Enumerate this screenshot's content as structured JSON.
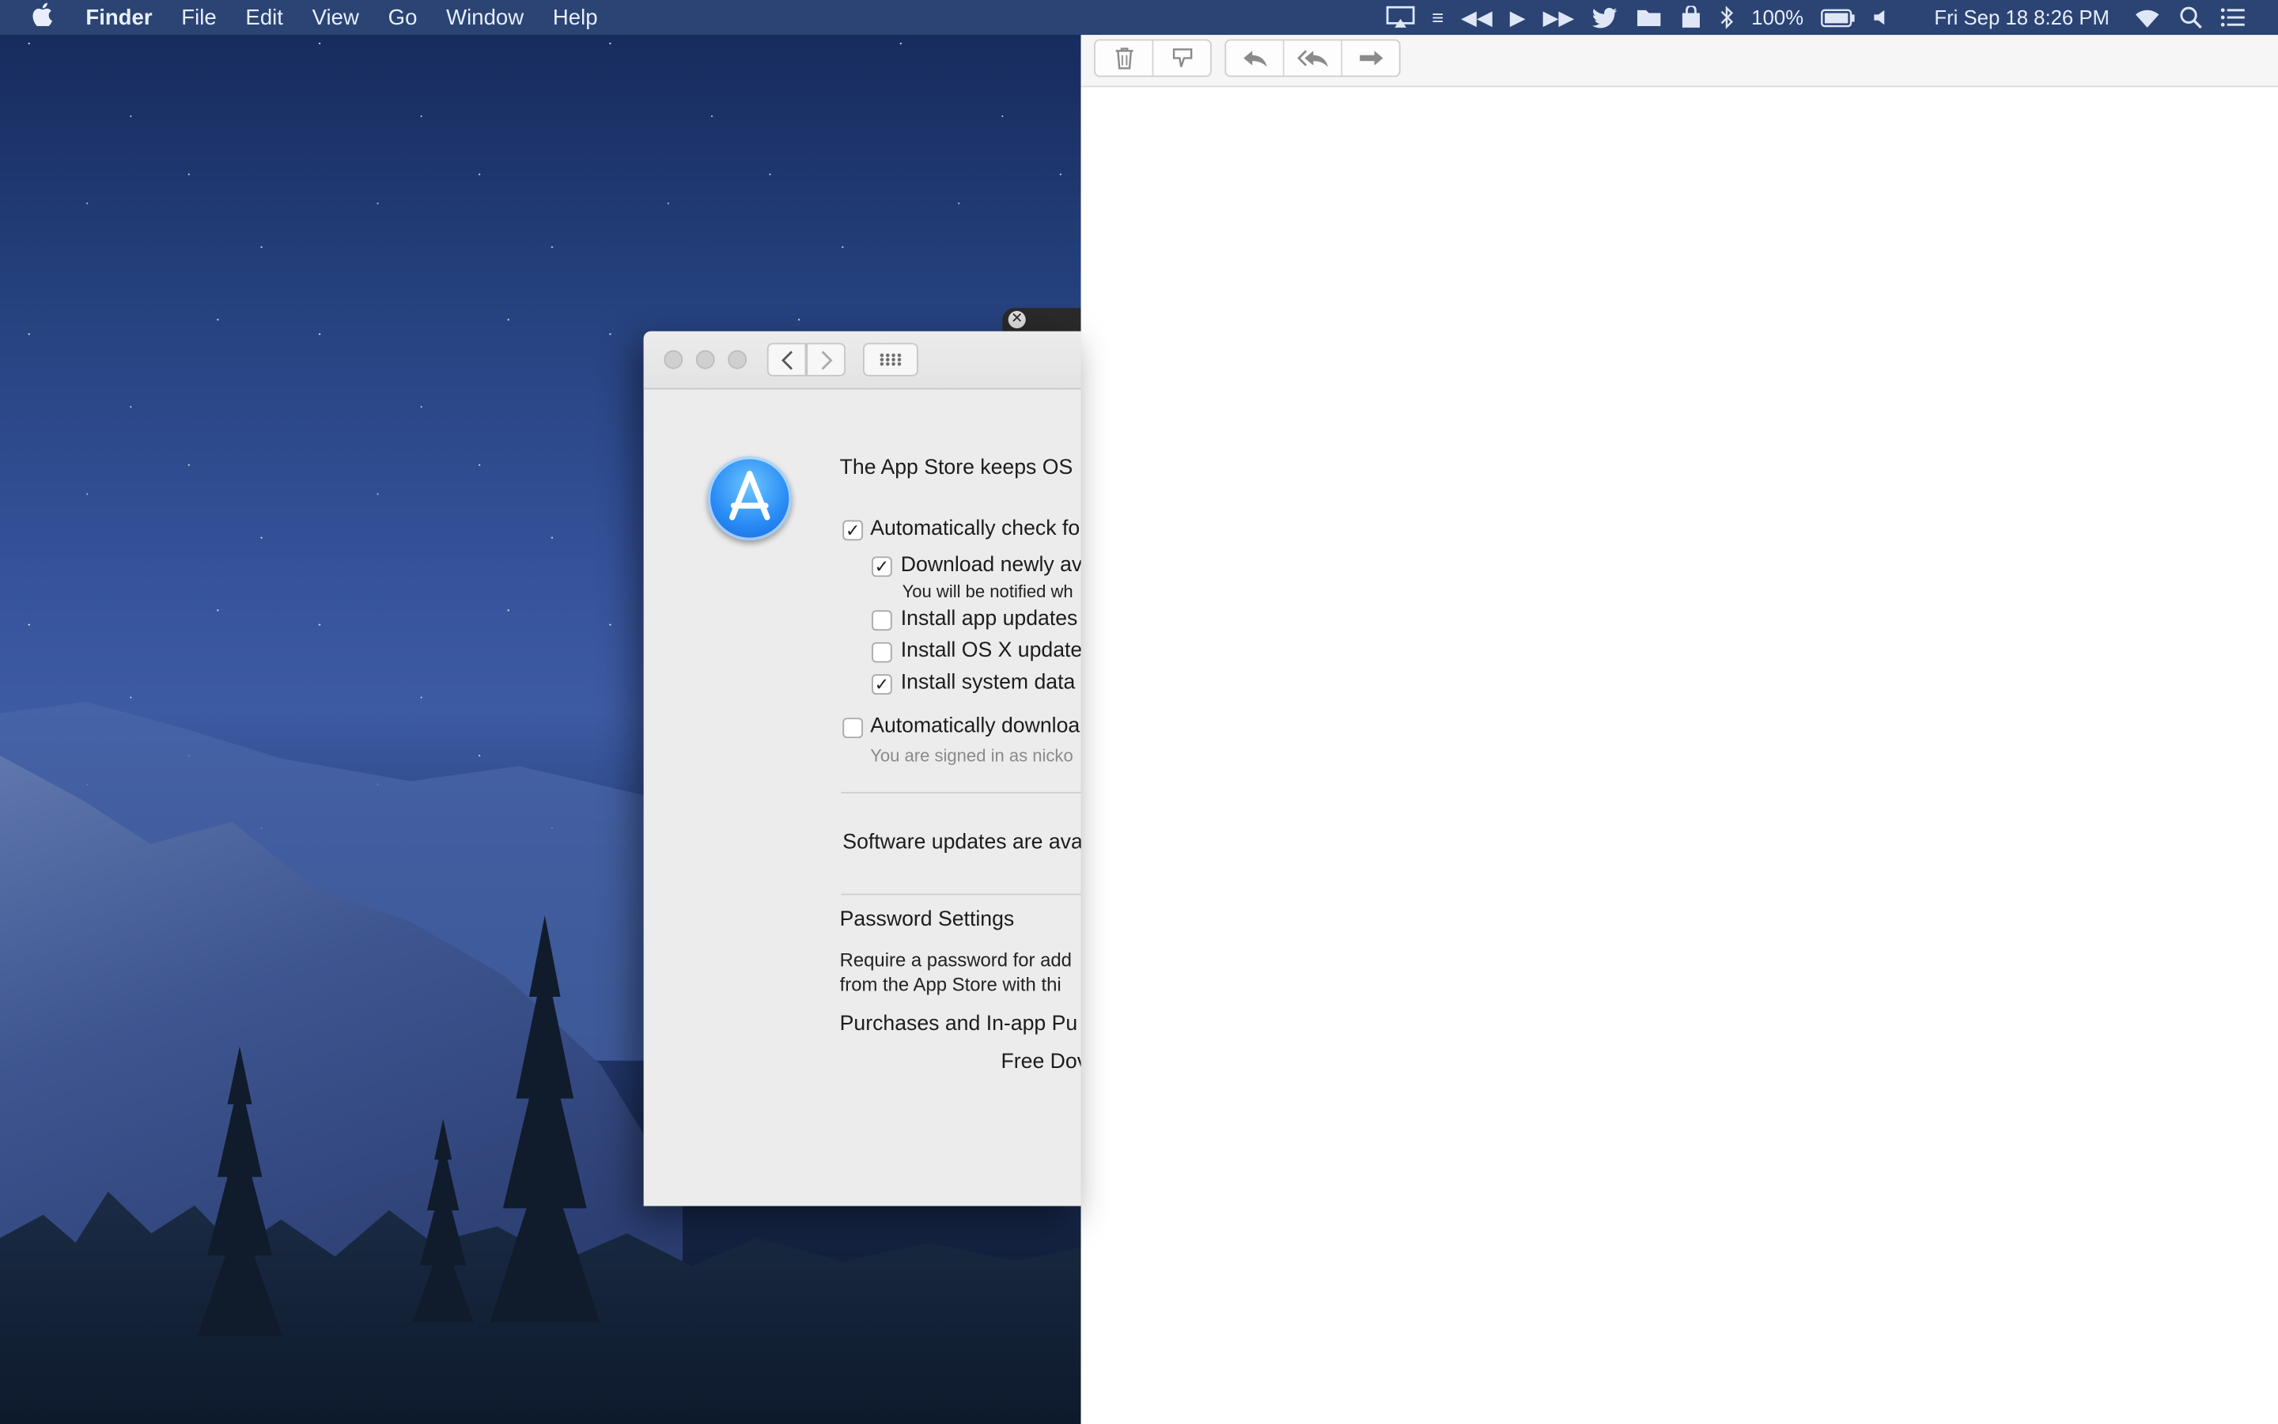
{
  "menubar": {
    "app_name": "Finder",
    "menus": [
      "File",
      "Edit",
      "View",
      "Go",
      "Window",
      "Help"
    ],
    "battery": "100%",
    "datetime": "Fri Sep 18  8:26 PM",
    "status_icons": [
      "airplay-icon",
      "list-icon",
      "rewind-icon",
      "play-icon",
      "fast-forward-icon",
      "twitter-icon",
      "folder-icon",
      "bag-icon",
      "bluetooth-icon",
      "battery-icon",
      "volume-icon",
      "wifi-icon",
      "spotlight-icon",
      "notification-center-icon"
    ]
  },
  "mail_toolbar": {
    "buttons": [
      "trash-icon",
      "junk-icon",
      "reply-icon",
      "reply-all-icon",
      "forward-icon"
    ]
  },
  "prefs": {
    "title_controls": [
      "close",
      "minimize",
      "zoom"
    ],
    "intro": "The App Store keeps OS",
    "auto_check": "Automatically check fo",
    "download_new": "Download newly av",
    "notified": "You will be notified wh",
    "install_app": "Install app updates",
    "install_osx": "Install OS X update",
    "install_system": "Install system data",
    "auto_download": "Automatically downloa",
    "signed_in": "You are signed in as nicko",
    "updates_available": "Software updates are ava",
    "password_settings": "Password Settings",
    "require_password_1": "Require a password for add",
    "require_password_2": "from the App Store with thi",
    "purchases": "Purchases and In-app Pu",
    "free_downloads": "Free Dov",
    "checkboxes": {
      "auto_check": true,
      "download_new": true,
      "install_app": false,
      "install_osx": false,
      "install_system": true,
      "auto_download": false
    }
  }
}
